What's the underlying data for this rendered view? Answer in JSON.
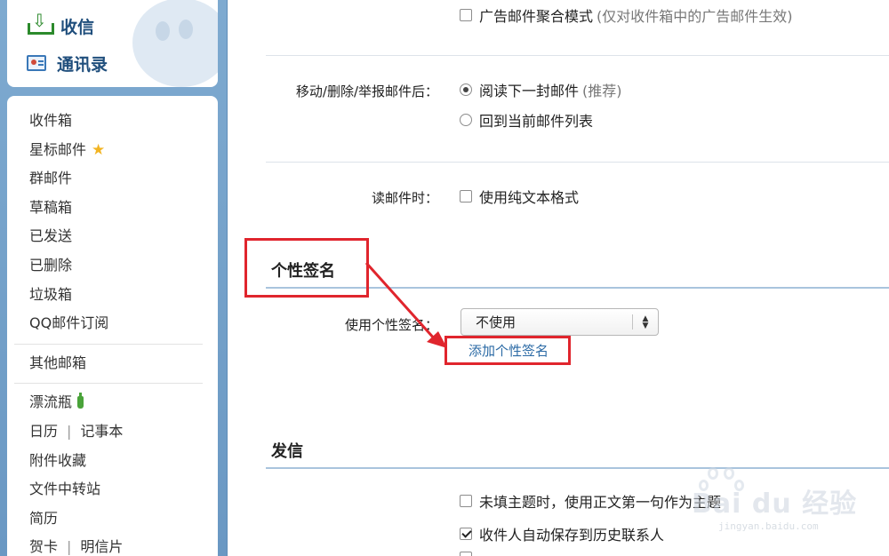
{
  "sidebar": {
    "quick": [
      {
        "label": "收信",
        "icon": "inbox-download-icon"
      },
      {
        "label": "通讯录",
        "icon": "contacts-card-icon"
      }
    ],
    "folders_a": [
      "收件箱",
      "星标邮件",
      "群邮件",
      "草稿箱",
      "已发送",
      "已删除",
      "垃圾箱",
      "QQ邮件订阅"
    ],
    "folders_b": [
      "其他邮箱"
    ],
    "folders_c": {
      "drift_bottle": "漂流瓶",
      "calendar": "日历",
      "sep": "|",
      "notebook": "记事本",
      "attachments": "附件收藏",
      "file_transfer": "文件中转站",
      "resume": "简历",
      "greeting_card": "贺卡",
      "postcard": "明信片"
    }
  },
  "settings": {
    "ad_aggregate": {
      "label": "广告邮件聚合模式",
      "hint": "(仅对收件箱中的广告邮件生效)",
      "checked": false
    },
    "after_action": {
      "label": "移动/删除/举报邮件后：",
      "options": [
        {
          "label": "阅读下一封邮件",
          "hint": "(推荐)",
          "selected": true
        },
        {
          "label": "回到当前邮件列表",
          "hint": "",
          "selected": false
        }
      ]
    },
    "read_mail": {
      "label": "读邮件时：",
      "option": "使用纯文本格式",
      "checked": false
    },
    "signature": {
      "title": "个性签名",
      "use_label": "使用个性签名：",
      "select_value": "不使用",
      "add_link": "添加个性签名"
    },
    "sending": {
      "title": "发信",
      "options": [
        {
          "label": "未填主题时，使用正文第一句作为主题",
          "checked": false
        },
        {
          "label": "收件人自动保存到历史联系人",
          "checked": true
        }
      ]
    }
  },
  "watermark": {
    "main": "Bai du 经验",
    "sub": "jingyan.baidu.com"
  },
  "colors": {
    "annotation": "#e0252d",
    "link": "#2b6aa5",
    "sidebar_bg": "#6f9ec7"
  }
}
